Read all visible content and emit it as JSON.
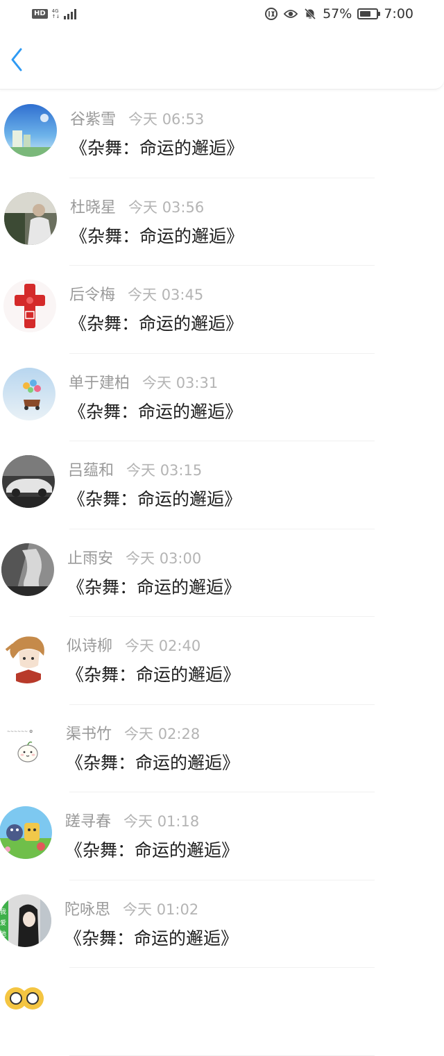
{
  "status_bar": {
    "hd_label": "HD",
    "network_label": "4G",
    "network_sub": "↑↓",
    "battery_text": "57%",
    "time": "7:00"
  },
  "nav": {
    "back_icon": "chevron-left-icon",
    "accent_color": "#2e9af3"
  },
  "items": [
    {
      "name": "谷紫雪",
      "time": "今天 06:53",
      "content": "《杂舞：命运的邂逅》"
    },
    {
      "name": "杜晓星",
      "time": "今天 03:56",
      "content": "《杂舞：命运的邂逅》"
    },
    {
      "name": "后令梅",
      "time": "今天 03:45",
      "content": "《杂舞：命运的邂逅》"
    },
    {
      "name": "单于建柏",
      "time": "今天 03:31",
      "content": "《杂舞：命运的邂逅》"
    },
    {
      "name": "吕蕴和",
      "time": "今天 03:15",
      "content": "《杂舞：命运的邂逅》"
    },
    {
      "name": "止雨安",
      "time": "今天 03:00",
      "content": "《杂舞：命运的邂逅》"
    },
    {
      "name": "似诗柳",
      "time": "今天 02:40",
      "content": "《杂舞：命运的邂逅》"
    },
    {
      "name": "渠书竹",
      "time": "今天 02:28",
      "content": "《杂舞：命运的邂逅》"
    },
    {
      "name": "蹉寻春",
      "time": "今天 01:18",
      "content": "《杂舞：命运的邂逅》"
    },
    {
      "name": "陀咏思",
      "time": "今天 01:02",
      "content": "《杂舞：命运的邂逅》"
    }
  ]
}
